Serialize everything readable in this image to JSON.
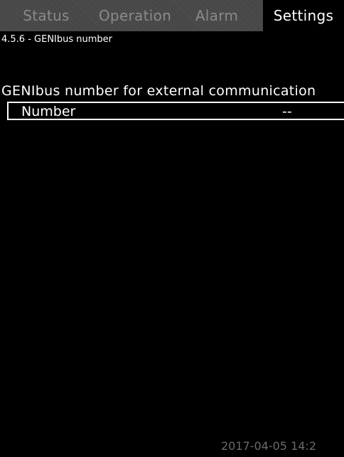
{
  "tabs": {
    "status": "Status",
    "operation": "Operation",
    "alarm": "Alarm",
    "settings": "Settings",
    "active": "Settings"
  },
  "breadcrumb": "4.5.6 - GENIbus number",
  "section_title": "GENIbus number for external communication",
  "field": {
    "label": "Number",
    "value": "--"
  },
  "timestamp": "2017-04-05 14:2",
  "colors": {
    "background": "#000000",
    "text": "#ffffff",
    "inactive_tab_text": "#8a8a8a",
    "timestamp_text": "#6a6a6a"
  }
}
